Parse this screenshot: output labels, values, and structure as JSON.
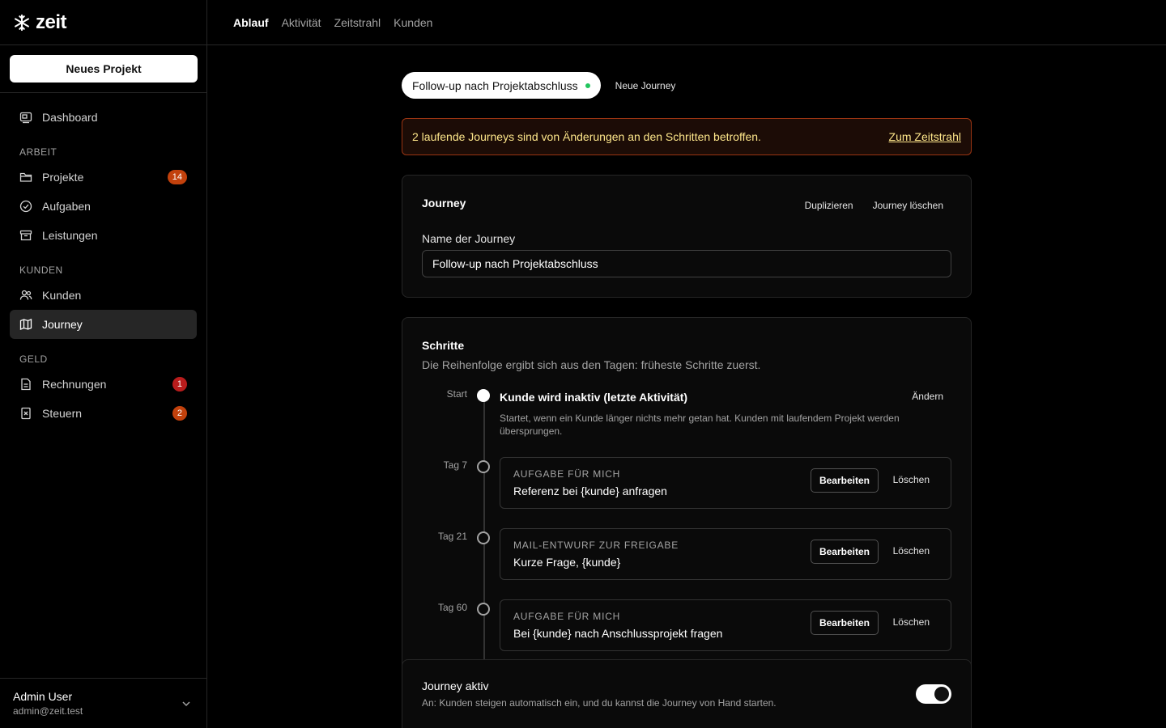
{
  "logo": {
    "text": "zeit"
  },
  "sidebar": {
    "new_project": "Neues Projekt",
    "dashboard": "Dashboard",
    "section_work": "ARBEIT",
    "projects": "Projekte",
    "projects_badge": "14",
    "tasks": "Aufgaben",
    "services": "Leistungen",
    "section_customers": "KUNDEN",
    "customers": "Kunden",
    "journey": "Journey",
    "section_money": "GELD",
    "invoices": "Rechnungen",
    "invoices_badge": "1",
    "taxes": "Steuern",
    "taxes_badge": "2"
  },
  "user": {
    "name": "Admin User",
    "email": "admin@zeit.test"
  },
  "topnav": {
    "tabs": [
      "Ablauf",
      "Aktivität",
      "Zeitstrahl",
      "Kunden"
    ],
    "active": "Ablauf"
  },
  "journey_tabs": {
    "active": "Follow-up nach Projektabschluss",
    "new": "Neue Journey"
  },
  "alert": {
    "text": "2 laufende Journeys sind von Änderungen an den Schritten betroffen.",
    "link": "Zum Zeitstrahl"
  },
  "journey_card": {
    "title": "Journey",
    "duplicate": "Duplizieren",
    "delete": "Journey löschen",
    "name_label": "Name der Journey",
    "name_value": "Follow-up nach Projektabschluss"
  },
  "steps_card": {
    "title": "Schritte",
    "subtitle": "Die Reihenfolge ergibt sich aus den Tagen: früheste Schritte zuerst.",
    "start_label": "Start",
    "start_title": "Kunde wird inaktiv (letzte Aktivität)",
    "start_change": "Ändern",
    "start_desc": "Startet, wenn ein Kunde länger nichts mehr getan hat. Kunden mit laufendem Projekt werden übersprungen.",
    "edit_label": "Bearbeiten",
    "delete_label": "Löschen",
    "steps": [
      {
        "day": "Tag 7",
        "kind": "AUFGABE FÜR MICH",
        "name": "Referenz bei {kunde} anfragen"
      },
      {
        "day": "Tag 21",
        "kind": "MAIL-ENTWURF ZUR FREIGABE",
        "name": "Kurze Frage, {kunde}"
      },
      {
        "day": "Tag 60",
        "kind": "AUFGABE FÜR MICH",
        "name": "Bei {kunde} nach Anschlussprojekt fragen"
      }
    ]
  },
  "active_card": {
    "title": "Journey aktiv",
    "desc": "An: Kunden steigen automatisch ein, und du kannst die Journey von Hand starten.",
    "toggle_on": true
  }
}
